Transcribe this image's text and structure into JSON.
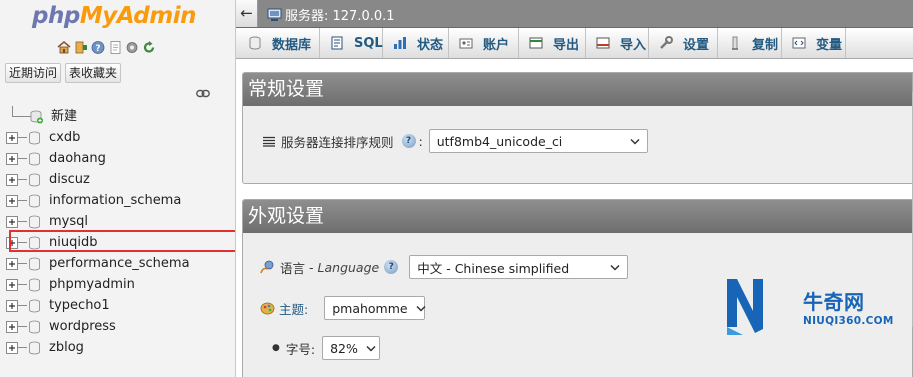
{
  "logo": {
    "part1": "php",
    "part2": "MyAdmin"
  },
  "quick_links": [
    "home-icon",
    "logout-icon",
    "help-icon",
    "docs-icon",
    "settings-icon",
    "reload-icon"
  ],
  "nav_buttons": {
    "recent": "近期访问",
    "favorites": "表收藏夹"
  },
  "tree": {
    "new_label": "新建",
    "databases": [
      "cxdb",
      "daohang",
      "discuz",
      "information_schema",
      "mysql",
      "niuqidb",
      "performance_schema",
      "phpmyadmin",
      "typecho1",
      "wordpress",
      "zblog"
    ],
    "highlighted": "niuqidb"
  },
  "topbar": {
    "back_label": "←",
    "server_label": "服务器: 127.0.0.1"
  },
  "tabs": [
    {
      "label": "数据库",
      "icon": "database-icon"
    },
    {
      "label": "SQL",
      "icon": "sql-icon"
    },
    {
      "label": "状态",
      "icon": "status-icon"
    },
    {
      "label": "账户",
      "icon": "accounts-icon"
    },
    {
      "label": "导出",
      "icon": "export-icon"
    },
    {
      "label": "导入",
      "icon": "import-icon"
    },
    {
      "label": "设置",
      "icon": "wrench-icon"
    },
    {
      "label": "复制",
      "icon": "replication-icon"
    },
    {
      "label": "变量",
      "icon": "variables-icon"
    }
  ],
  "general_settings": {
    "title": "常规设置",
    "collation_label": "服务器连接排序规则",
    "collation_value": "utf8mb4_unicode_ci"
  },
  "appearance_settings": {
    "title": "外观设置",
    "language_label": "语言",
    "language_label_en": "Language",
    "language_value": "中文 - Chinese simplified",
    "theme_label": "主题:",
    "theme_value": "pmahomme",
    "font_label": "字号:",
    "font_value": "82%"
  },
  "watermark": {
    "title": "牛奇网",
    "subtitle": "NIUQI360.COM"
  },
  "colors": {
    "logo_blue": "#6c78af",
    "logo_orange": "#f89c0e",
    "tab_text": "#235a81",
    "panel_header": "#7a7a7a",
    "highlight_red": "#e03030",
    "watermark_blue": "#1865b8"
  }
}
